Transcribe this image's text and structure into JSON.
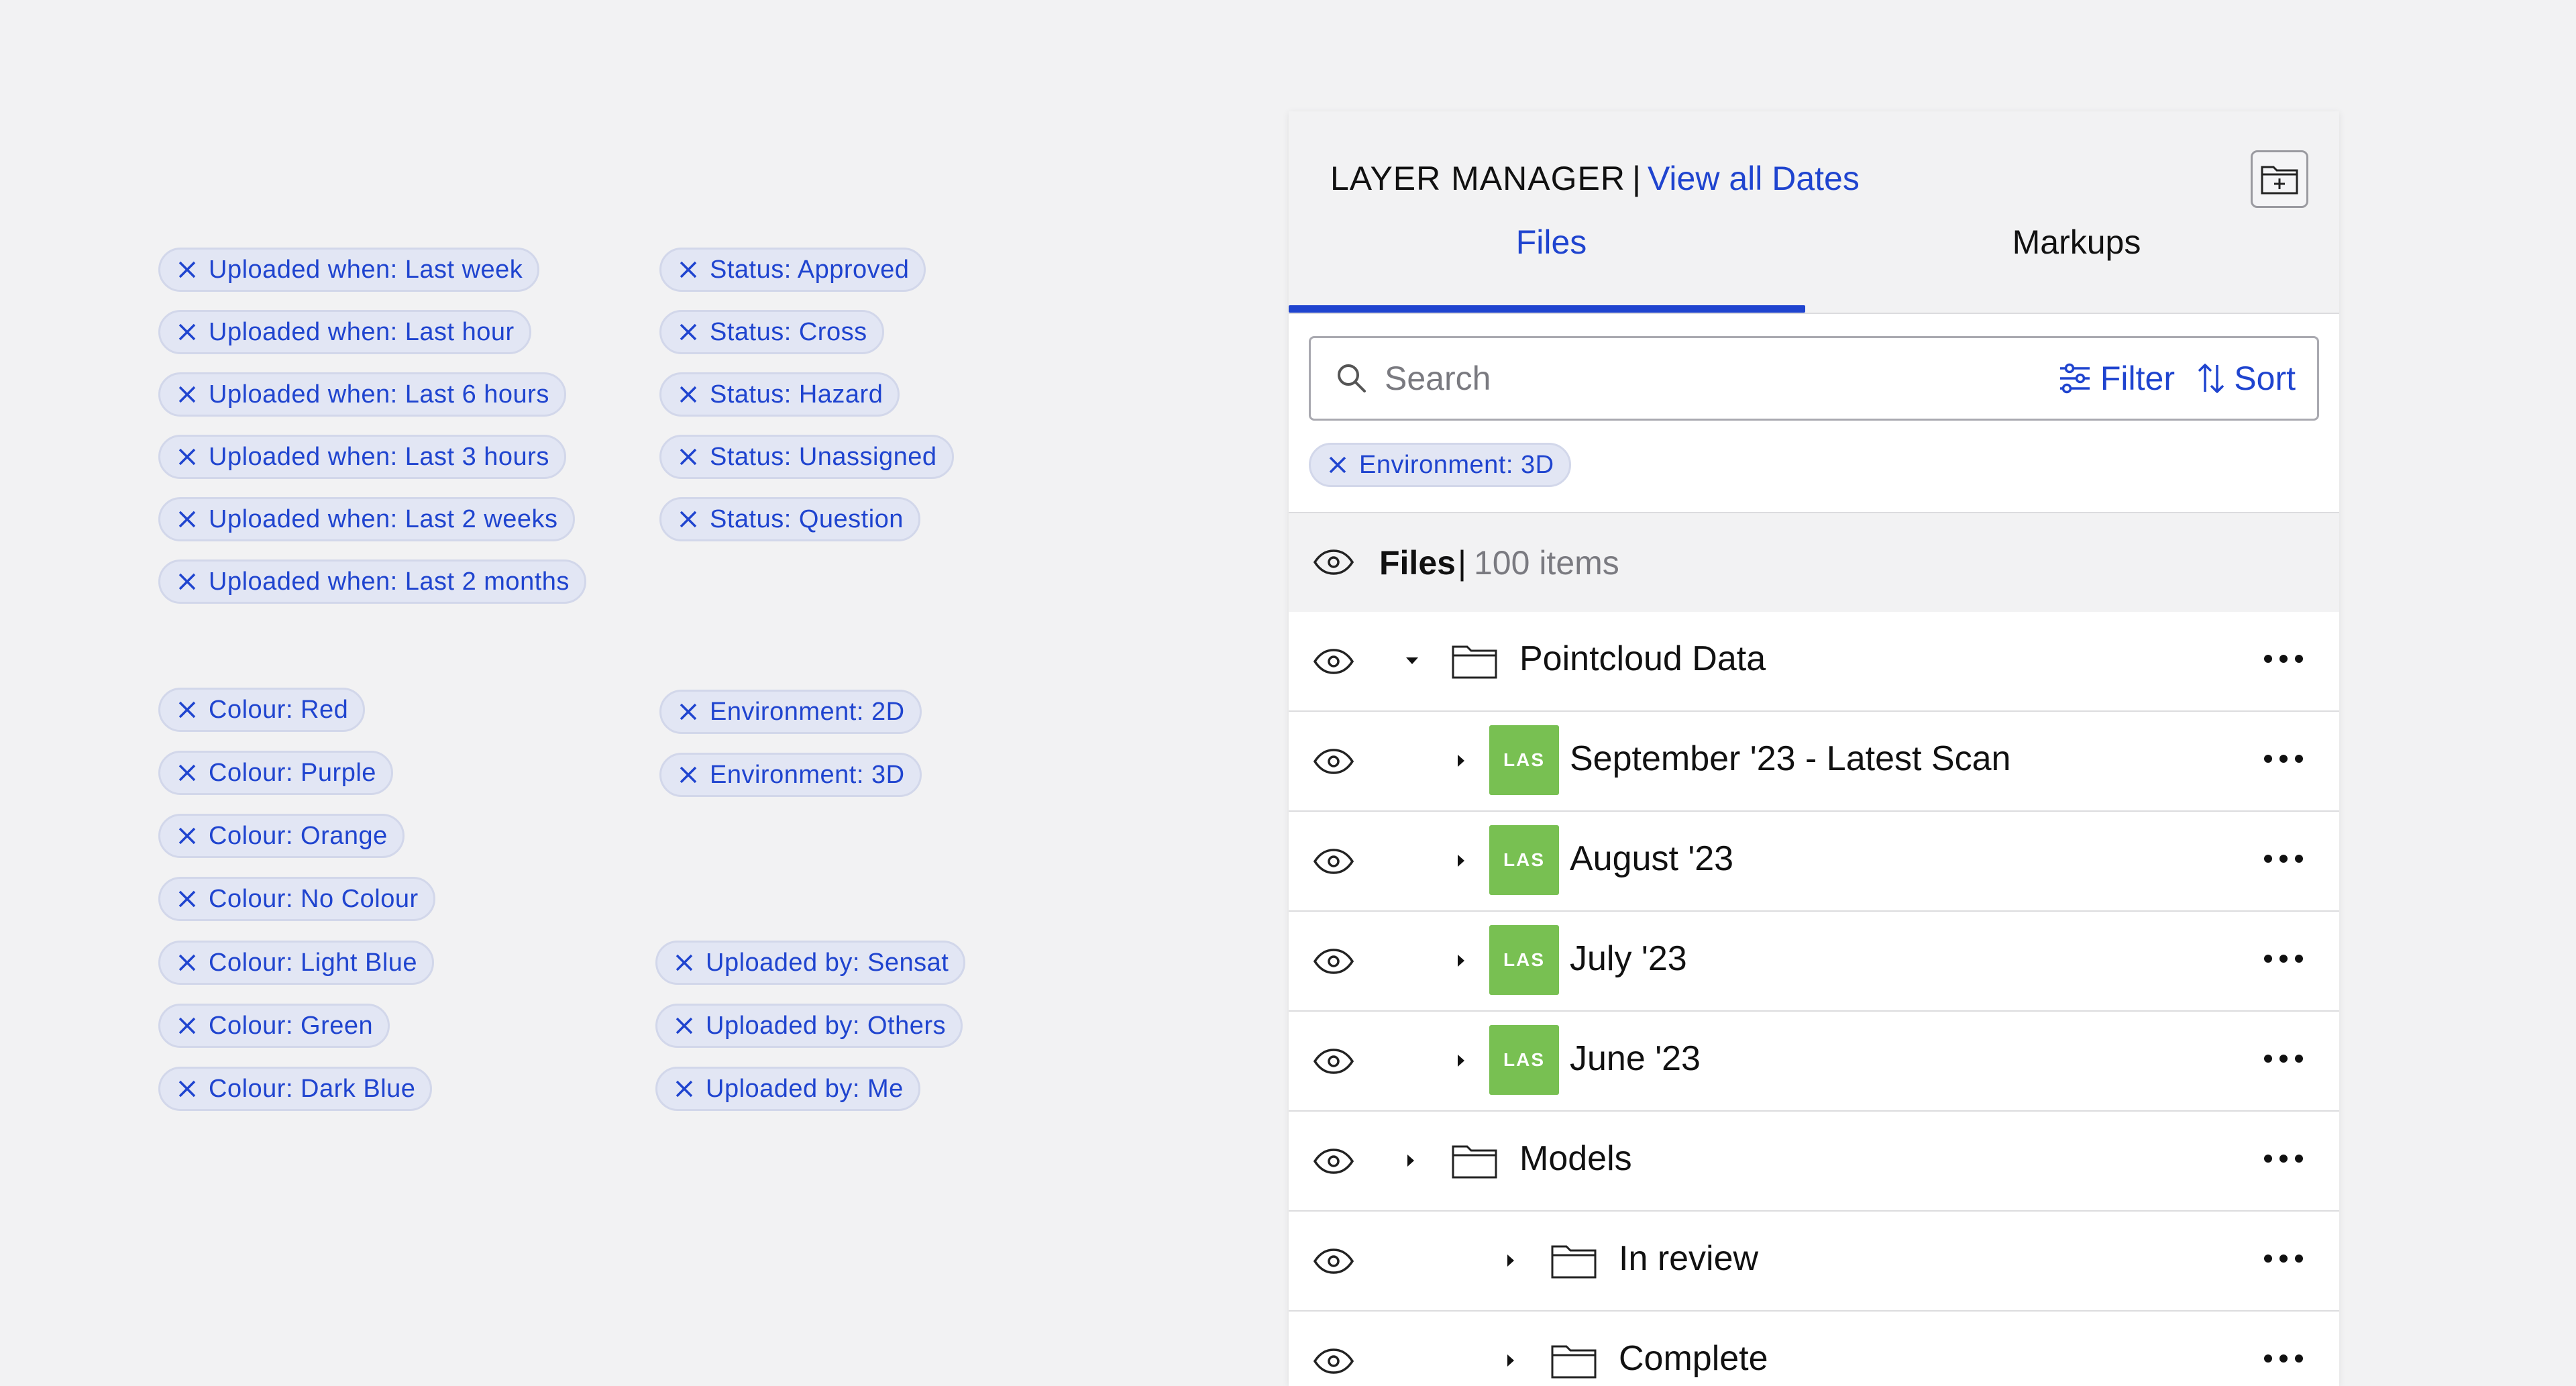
{
  "chips_left_top": [
    "Uploaded when: Last week",
    "Uploaded when: Last hour",
    "Uploaded when: Last 6 hours",
    "Uploaded when: Last 3 hours",
    "Uploaded when: Last 2 weeks",
    "Uploaded when: Last 2 months"
  ],
  "chips_right_top": [
    "Status: Approved",
    "Status: Cross",
    "Status: Hazard",
    "Status: Unassigned",
    "Status: Question"
  ],
  "chips_left_bottom": [
    "Colour: Red",
    "Colour: Purple",
    "Colour: Orange",
    "Colour: No Colour",
    "Colour: Light Blue",
    "Colour: Green",
    "Colour: Dark Blue"
  ],
  "chips_env": [
    "Environment: 2D",
    "Environment: 3D"
  ],
  "chips_uploaded_by": [
    "Uploaded by: Sensat",
    "Uploaded by: Others",
    "Uploaded by: Me"
  ],
  "panel": {
    "title": "LAYER MANAGER",
    "separator": "|",
    "link": "View all Dates",
    "tabs": [
      "Files",
      "Markups"
    ],
    "search": {
      "placeholder": "Search",
      "value": ""
    },
    "filter_label": "Filter",
    "sort_label": "Sort",
    "active_filter": "Environment: 3D",
    "section": {
      "title": "Files",
      "separator": "|",
      "count": "100 items"
    },
    "rows": [
      {
        "label": "Pointcloud Data"
      },
      {
        "label": "September '23 - Latest Scan",
        "badge": "LAS"
      },
      {
        "label": "August '23",
        "badge": "LAS"
      },
      {
        "label": "July '23",
        "badge": "LAS"
      },
      {
        "label": "June '23",
        "badge": "LAS"
      },
      {
        "label": "Models"
      },
      {
        "label": "In review"
      },
      {
        "label": "Complete"
      }
    ]
  },
  "colors": {
    "accent": "#1f44cf",
    "chip_bg": "#e2e6f4",
    "las_green": "#78c052"
  },
  "icons": [
    "close-icon",
    "folder-add-icon",
    "search-icon",
    "filter-icon",
    "sort-icon",
    "eye-icon",
    "caret-down-icon",
    "caret-right-icon",
    "folder-icon",
    "more-icon"
  ]
}
